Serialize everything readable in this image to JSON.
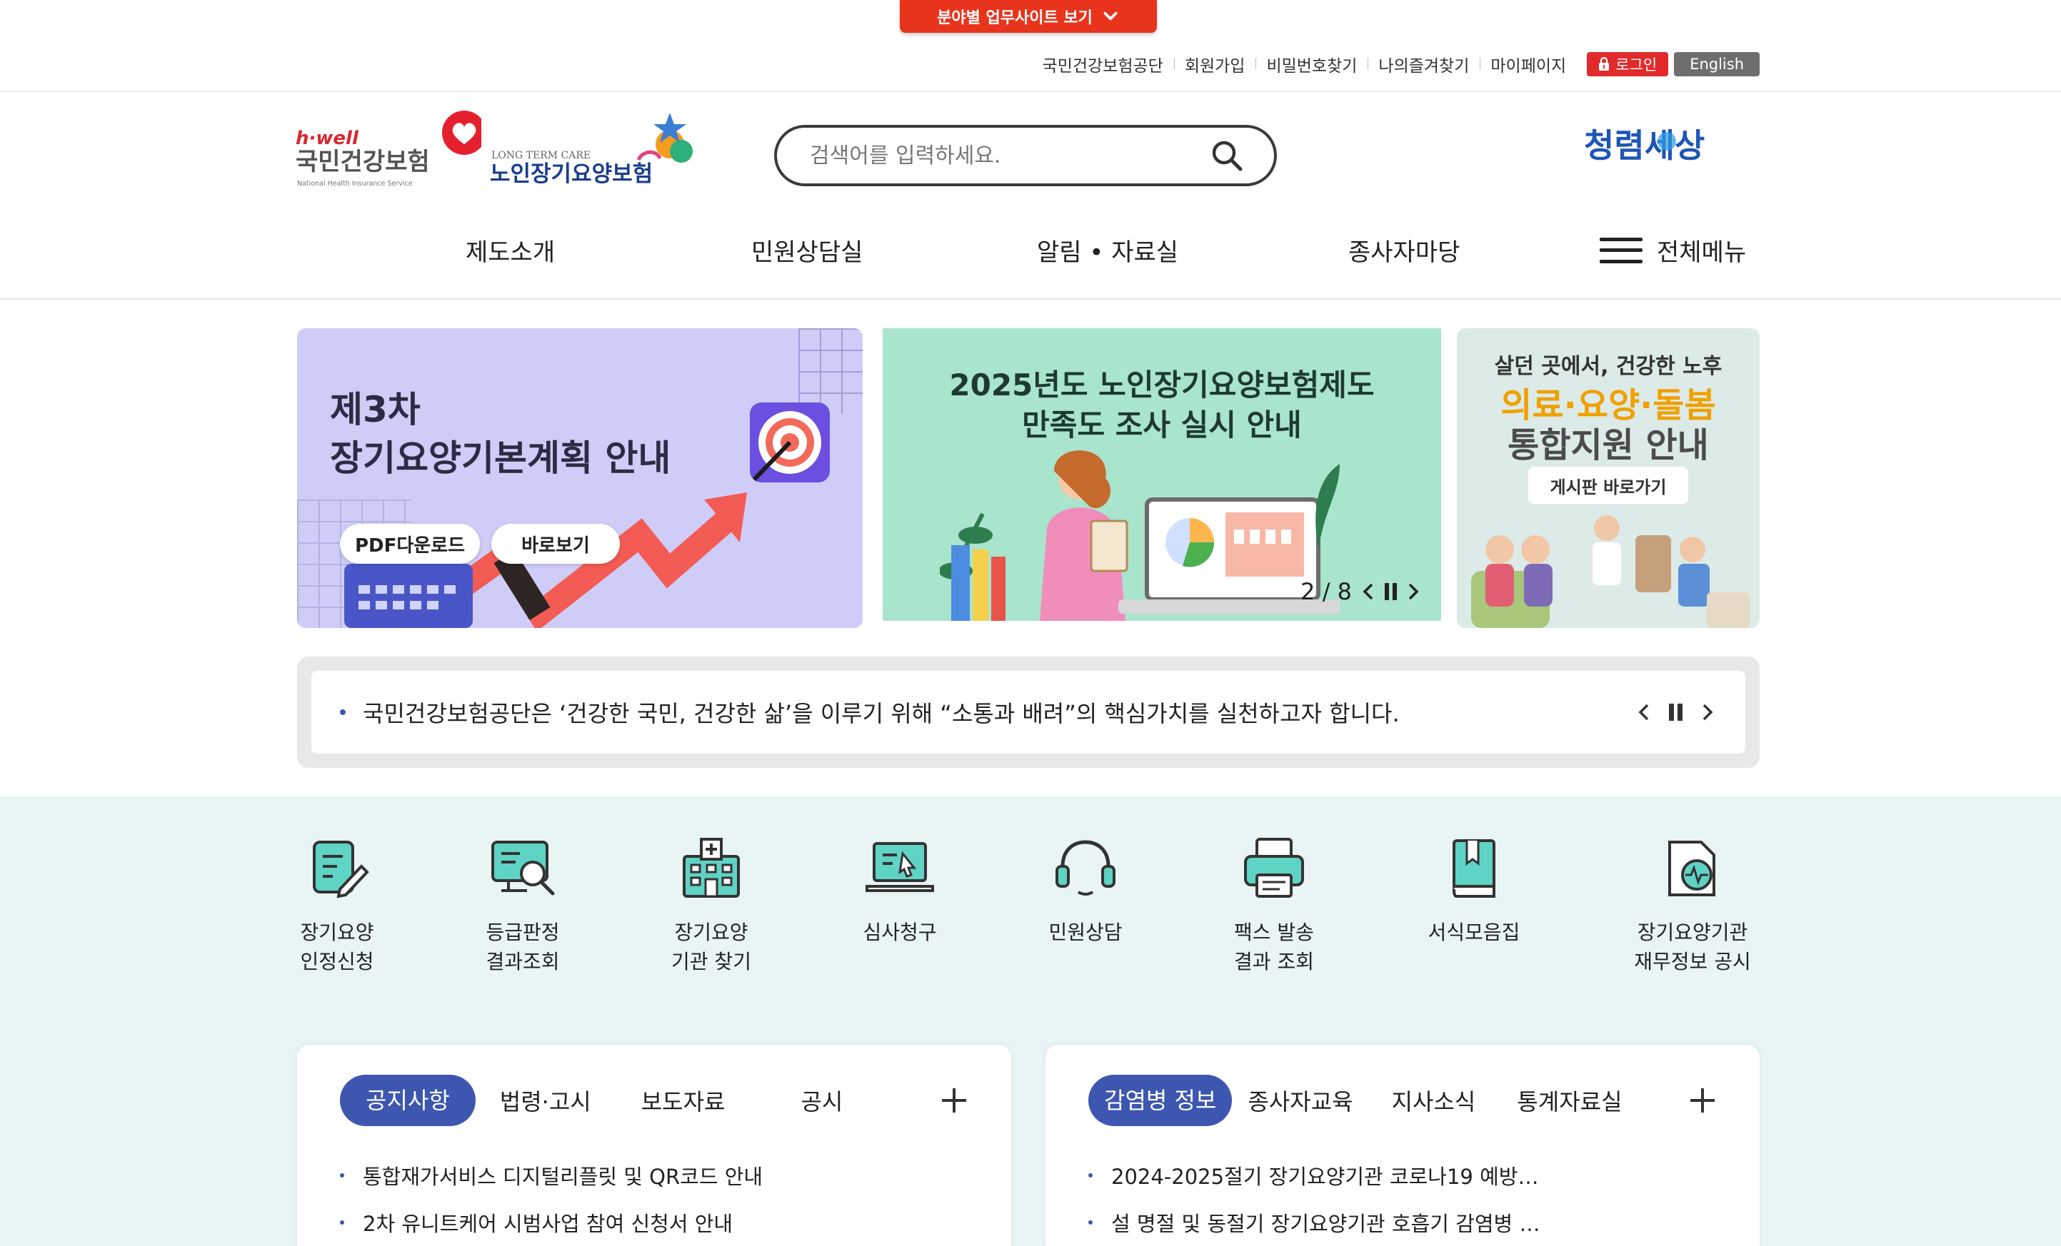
{
  "top_tab": {
    "label": "분야별 업무사이트 보기"
  },
  "utility": {
    "links": [
      "국민건강보험공단",
      "회원가입",
      "비밀번호찾기",
      "나의즐겨찾기",
      "마이페이지"
    ],
    "login": "로그인",
    "english": "English"
  },
  "logos": {
    "nhis_small": "h·well",
    "nhis": "국민건강보험",
    "nhis_en": "National Health Insurance Service",
    "ltc_en": "LONG TERM CARE",
    "ltc": "노인장기요양보험",
    "clean": "청렴세상"
  },
  "search": {
    "placeholder": "검색어를 입력하세요."
  },
  "gnb": {
    "items": [
      "제도소개",
      "민원상담실",
      "알림 • 자료실",
      "종사자마당"
    ],
    "all_menu": "전체메뉴"
  },
  "banners": {
    "b1": {
      "title_1": "제3차",
      "title_2": "장기요양기본계획 안내",
      "btn_pdf": "PDF다운로드",
      "btn_view": "바로보기"
    },
    "b2": {
      "title_1": "2025년도 노인장기요양보험제도",
      "title_2": "만족도 조사 실시 안내",
      "pager": "2 / 8"
    },
    "b3": {
      "title_1": "살던 곳에서, 건강한 노후",
      "title_2": "의료·요양·돌봄",
      "title_3": "통합지원 안내",
      "board": "게시판 바로가기"
    }
  },
  "notice": {
    "text": "국민건강보험공단은 ‘건강한 국민, 건강한 삶’을 이루기 위해 “소통과 배려”의 핵심가치를 실천하고자 합니다."
  },
  "quick": {
    "items": [
      {
        "label": "장기요양\n인정신청",
        "icon": "application-pen-icon"
      },
      {
        "label": "등급판정\n결과조회",
        "icon": "monitor-search-icon"
      },
      {
        "label": "장기요양\n기관 찾기",
        "icon": "hospital-building-icon"
      },
      {
        "label": "심사청구",
        "icon": "laptop-cursor-icon"
      },
      {
        "label": "민원상담",
        "icon": "headset-icon"
      },
      {
        "label": "팩스 발송\n결과 조회",
        "icon": "fax-printer-icon"
      },
      {
        "label": "서식모음집",
        "icon": "book-icon"
      },
      {
        "label": "장기요양기관\n재무정보 공시",
        "icon": "document-chart-icon"
      }
    ]
  },
  "boards": {
    "left": {
      "tabs": [
        "공지사항",
        "법령·고시",
        "보도자료",
        "공시"
      ],
      "rows": [
        "통합재가서비스 디지털리플릿 및 QR코드 안내",
        "2차 유니트케어 시범사업 참여 신청서 안내"
      ]
    },
    "right": {
      "tabs": [
        "감염병 정보",
        "종사자교육",
        "지사소식",
        "통계자료실"
      ],
      "rows": [
        "2024-2025절기 장기요양기관 코로나19 예방…",
        "설 명절 및 동절기 장기요양기관 호흡기 감염병 …"
      ]
    }
  },
  "colors": {
    "accent": "#3d57b0",
    "brand_red": "#e8341c",
    "mint_bg": "#e8f5f4"
  }
}
